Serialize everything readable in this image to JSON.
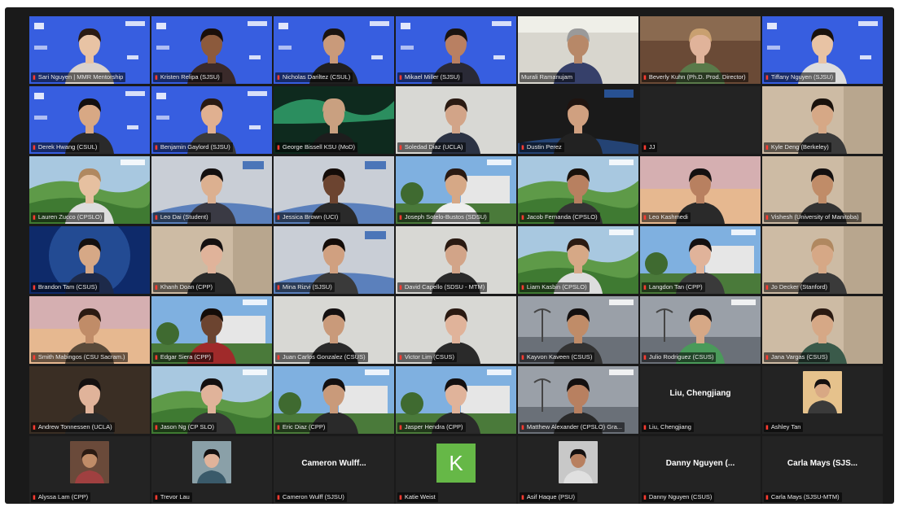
{
  "app": {
    "view": "gallery"
  },
  "colors": {
    "speaking_border": "#c8e04a",
    "mic_muted": "#ff3b30",
    "avatar_green": "#66b847"
  },
  "icons": {
    "muted": "microphone-muted-icon"
  },
  "mic_glyph": "▮",
  "participants": [
    {
      "name": "Sari Nguyen | MMR Mentorship",
      "muted": true,
      "bg": "blue-banner",
      "skin": "#e8c3a4",
      "hair": "#2a1a12",
      "shirt": "#d9d2cc"
    },
    {
      "name": "Kristen Relipa (SJSU)",
      "muted": true,
      "bg": "blue-banner",
      "skin": "#8c5a3c",
      "hair": "#1a0f0a",
      "shirt": "#3a2a2a"
    },
    {
      "name": "Nicholas Dariltez (CSUL)",
      "muted": true,
      "bg": "blue-banner",
      "skin": "#c99a7a",
      "hair": "#1b1410",
      "shirt": "#202020"
    },
    {
      "name": "Mikael Miller (SJSU)",
      "muted": true,
      "bg": "blue-banner",
      "skin": "#b98062",
      "hair": "#1b1410",
      "shirt": "#2a2a36"
    },
    {
      "name": "Murali Ramanujam",
      "muted": false,
      "bg": "office-light",
      "skin": "#b78868",
      "hair": "#9a9a9a",
      "shirt": "#36406a",
      "speaking": true
    },
    {
      "name": "Beverly Kuhn (Ph.D. Prod. Director)",
      "muted": true,
      "bg": "wood-room",
      "skin": "#e0b39a",
      "hair": "#c9a070",
      "shirt": "#5a7a4a"
    },
    {
      "name": "Tiffany Nguyen (SJSU)",
      "muted": true,
      "bg": "blue-banner",
      "skin": "#e8c3a4",
      "hair": "#1a120c",
      "shirt": "#ddd"
    },
    {
      "name": "Derek Hwang (CSUL)",
      "muted": true,
      "bg": "blue-banner",
      "skin": "#d8a884",
      "hair": "#141010",
      "shirt": "#2a2a2a"
    },
    {
      "name": "Benjamin Gaylord (SJSU)",
      "muted": true,
      "bg": "blue-banner",
      "skin": "#e0b090",
      "hair": "#2a1a12",
      "shirt": "#3a3a3a"
    },
    {
      "name": "George Bissell KSU (MoD)",
      "muted": true,
      "bg": "aurora",
      "skin": "#c9a080",
      "hair": "#c9a080",
      "shirt": "#1d1d1d"
    },
    {
      "name": "Soledad Diaz (UCLA)",
      "muted": true,
      "bg": "plain-wall",
      "skin": "#d2a488",
      "hair": "#2a1a12",
      "shirt": "#2c3344"
    },
    {
      "name": "Dustin Perez",
      "muted": true,
      "bg": "dark-banner",
      "skin": "#d0a080",
      "hair": "#201410",
      "shirt": "#222"
    },
    {
      "name": "JJ",
      "muted": true,
      "bg": "black",
      "video_off": true
    },
    {
      "name": "Kyle Deng (Berkeley)",
      "muted": true,
      "bg": "room-beige",
      "skin": "#d6a886",
      "hair": "#1a120c",
      "shirt": "#3a3a3a"
    },
    {
      "name": "Lauren Zucco (CPSLO)",
      "muted": true,
      "bg": "green-hills",
      "skin": "#e6c0a0",
      "hair": "#b08860",
      "shirt": "#ddd"
    },
    {
      "name": "Leo Dai (Student)",
      "muted": true,
      "bg": "grey-banner",
      "skin": "#dcb090",
      "hair": "#141010",
      "shirt": "#3a3a44"
    },
    {
      "name": "Jessica Brown (UCI)",
      "muted": true,
      "bg": "grey-banner",
      "skin": "#6c4430",
      "hair": "#140c08",
      "shirt": "#2a2a2a"
    },
    {
      "name": "Joseph Sotelo-Bustos (SDSU)",
      "muted": true,
      "bg": "campus",
      "skin": "#d6a886",
      "hair": "#2a1a12",
      "shirt": "#eee"
    },
    {
      "name": "Jacob Fernanda (CPSLO)",
      "muted": true,
      "bg": "green-hills",
      "skin": "#b88060",
      "hair": "#1a120c",
      "shirt": "#333"
    },
    {
      "name": "Leo Kashmedi",
      "muted": true,
      "bg": "sunset",
      "skin": "#b88060",
      "hair": "#141010",
      "shirt": "#2a2a2a"
    },
    {
      "name": "Vishesh (University of Manitoba)",
      "muted": true,
      "bg": "room-beige",
      "skin": "#c08c68",
      "hair": "#141010",
      "shirt": "#333"
    },
    {
      "name": "Brandon Tam (CSUS)",
      "muted": true,
      "bg": "blue-glow",
      "skin": "#d6a886",
      "hair": "#141010",
      "shirt": "#1d2a4a"
    },
    {
      "name": "Khanh Doan (CPP)",
      "muted": true,
      "bg": "room-beige",
      "skin": "#e0b39a",
      "hair": "#141010",
      "shirt": "#2a2a2a"
    },
    {
      "name": "Mina Rizvi (SJSU)",
      "muted": true,
      "bg": "grey-banner",
      "skin": "#d0a080",
      "hair": "#140c08",
      "shirt": "#3a3a3a"
    },
    {
      "name": "David Capello (SDSU - MTM)",
      "muted": true,
      "bg": "plain-wall",
      "skin": "#d2a488",
      "hair": "#2a1a12",
      "shirt": "#2a2a2a"
    },
    {
      "name": "Liam Kasbin (CPSLO)",
      "muted": true,
      "bg": "green-hills",
      "skin": "#d6a886",
      "hair": "#2a1a12",
      "shirt": "#ddd"
    },
    {
      "name": "Langdon Tan (CPP)",
      "muted": true,
      "bg": "campus",
      "skin": "#e0b39a",
      "hair": "#141010",
      "shirt": "#3a3a3a"
    },
    {
      "name": "Jo Decker (Stanford)",
      "muted": true,
      "bg": "room-beige",
      "skin": "#d6a886",
      "hair": "#b08860",
      "shirt": "#3a3a3a"
    },
    {
      "name": "Smith Mabingos (CSU Sacram.)",
      "muted": true,
      "bg": "sunset",
      "skin": "#c08c68",
      "hair": "#2a1a12",
      "shirt": "#5a4a3a"
    },
    {
      "name": "Edgar Siera (CPP)",
      "muted": true,
      "bg": "campus",
      "skin": "#6c4430",
      "hair": "#140c08",
      "shirt": "#a02a2a"
    },
    {
      "name": "Juan Carlos Gonzalez (CSUS)",
      "muted": true,
      "bg": "plain-wall",
      "skin": "#c99a7a",
      "hair": "#141010",
      "shirt": "#2a2a2a"
    },
    {
      "name": "Victor Lim (CSUS)",
      "muted": true,
      "bg": "plain-wall",
      "skin": "#e0b39a",
      "hair": "#2a1a12",
      "shirt": "#2a2a2a"
    },
    {
      "name": "Kayvon Kaveen (CSUS)",
      "muted": true,
      "bg": "palms-grey",
      "skin": "#c08c68",
      "hair": "#141010",
      "shirt": "#333"
    },
    {
      "name": "Julio Rodriguez (CSUS)",
      "muted": true,
      "bg": "palms-grey",
      "skin": "#d6a886",
      "hair": "#141010",
      "shirt": "#4a9a5a"
    },
    {
      "name": "Jana Vargas (CSUS)",
      "muted": true,
      "bg": "room-beige",
      "skin": "#d6a886",
      "hair": "#2a1a12",
      "shirt": "#3a5a4a"
    },
    {
      "name": "Andrew Tonnessen (UCLA)",
      "muted": true,
      "bg": "dark-room",
      "skin": "#e0b39a",
      "hair": "#141010",
      "shirt": "#2a2a2a"
    },
    {
      "name": "Jason Ng (CP SLO)",
      "muted": true,
      "bg": "green-hills",
      "skin": "#e0b39a",
      "hair": "#141010",
      "shirt": "#333"
    },
    {
      "name": "Eric Diaz (CPP)",
      "muted": true,
      "bg": "campus",
      "skin": "#c99a7a",
      "hair": "#141010",
      "shirt": "#2a2a2a"
    },
    {
      "name": "Jasper Hendra (CPP)",
      "muted": true,
      "bg": "campus",
      "skin": "#e0b39a",
      "hair": "#141010",
      "shirt": "#2a2a2a"
    },
    {
      "name": "Matthew Alexander (CPSLO) Gra...",
      "muted": true,
      "bg": "palms-grey",
      "skin": "#b88060",
      "hair": "#141010",
      "shirt": "#2a2a2a"
    },
    {
      "name": "Liu, Chengjiang",
      "muted": true,
      "bg": "black",
      "video_off": true,
      "center_name": "Liu, Chengjiang"
    },
    {
      "name": "Ashley Tan",
      "muted": true,
      "bg": "black",
      "video_off": true,
      "photo": true,
      "skin": "#d8a884",
      "hair": "#141010",
      "shirt": "#3a3a3a",
      "photo_bg": "#e6c28c"
    },
    {
      "name": "Alyssa Lam (CPP)",
      "muted": true,
      "bg": "black",
      "video_off": true,
      "photo": true,
      "skin": "#c08c68",
      "hair": "#2a1a12",
      "shirt": "#a04040",
      "photo_bg": "#6a4a3a"
    },
    {
      "name": "Trevor Lau",
      "muted": true,
      "bg": "black",
      "video_off": true,
      "photo": true,
      "skin": "#e0b39a",
      "hair": "#141010",
      "shirt": "#3a5a6a",
      "photo_bg": "#8aa0a8"
    },
    {
      "name": "Cameron Wulff (SJSU)",
      "muted": true,
      "bg": "black",
      "video_off": true,
      "center_name": "Cameron Wulff..."
    },
    {
      "name": "Katie Weist",
      "muted": true,
      "bg": "black",
      "video_off": true,
      "letter": "K"
    },
    {
      "name": "Asif Haque (PSU)",
      "muted": true,
      "bg": "black",
      "video_off": true,
      "photo": true,
      "skin": "#b88060",
      "hair": "#141010",
      "shirt": "#e0e0e0",
      "photo_bg": "#c8c8c8"
    },
    {
      "name": "Danny Nguyen (CSUS)",
      "muted": true,
      "bg": "black",
      "video_off": true,
      "center_name": "Danny Nguyen (..."
    },
    {
      "name": "Carla Mays (SJSU-MTM)",
      "muted": true,
      "bg": "black",
      "video_off": true,
      "center_name": "Carla Mays (SJS..."
    }
  ]
}
